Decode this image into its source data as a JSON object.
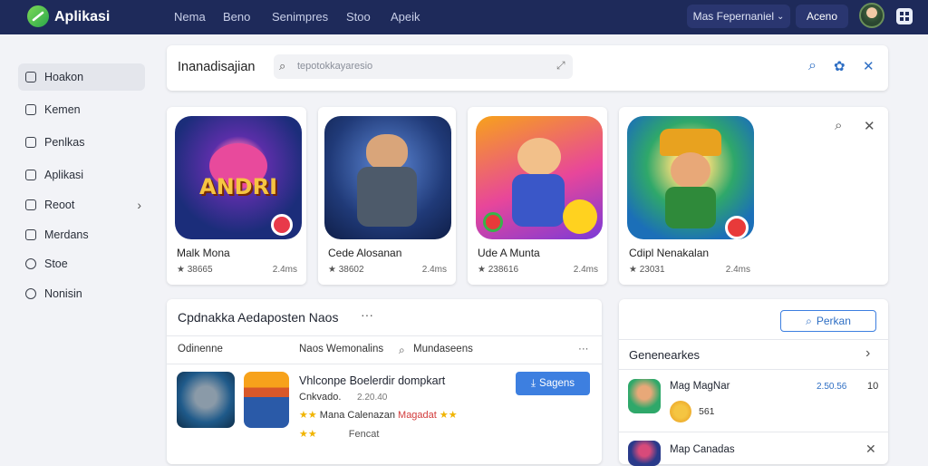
{
  "header": {
    "brand": "Aplikasi",
    "nav": [
      "Nema",
      "Beno",
      "Senimpres",
      "Stoo",
      "Apeik"
    ],
    "lang_label": "Mas Fepernaniel",
    "login_label": "Aceno"
  },
  "sidebar": {
    "items": [
      "Hoakon",
      "Kemen",
      "Penlkas",
      "Aplikasi",
      "Reoot",
      "Merdans",
      "Stoe",
      "Nonisin"
    ]
  },
  "search": {
    "title": "Inanadisajian",
    "placeholder": "tepotokkayaresio"
  },
  "games": [
    {
      "name": "Malk Mona",
      "rating": "★ 38665",
      "size": "2.4ms",
      "logo_text": "ANDRI"
    },
    {
      "name": "Cede Alosanan",
      "rating": "★ 38602",
      "size": "2.4ms"
    },
    {
      "name": "Ude A Munta",
      "rating": "★ 238616",
      "size": "2.4ms"
    },
    {
      "name": "Cdipl Nenakalan",
      "rating": "★ 23031",
      "size": "2.4ms"
    }
  ],
  "recommend": {
    "title": "Cpdnakka Aedaposten Naos",
    "tabs": [
      "Odinenne",
      "Naos Wemonalins",
      "Mundaseens"
    ],
    "item": {
      "title": "Vhlconpe Boelerdir dompkart",
      "sub": "Cnkvado.",
      "sub_meta": "2.20.40",
      "line2_text": "Mana Calenazan",
      "line2_tag": "Magadat",
      "line3": "Fencat",
      "btn": "Sagens"
    }
  },
  "genre": {
    "btn": "Perkan",
    "title": "Genenearkes",
    "item1_name": "Mag MagNar",
    "item1_meta": "2.50.56",
    "item1_sub": "561",
    "item1_count": "10",
    "item2_name": "Map Canadas"
  }
}
